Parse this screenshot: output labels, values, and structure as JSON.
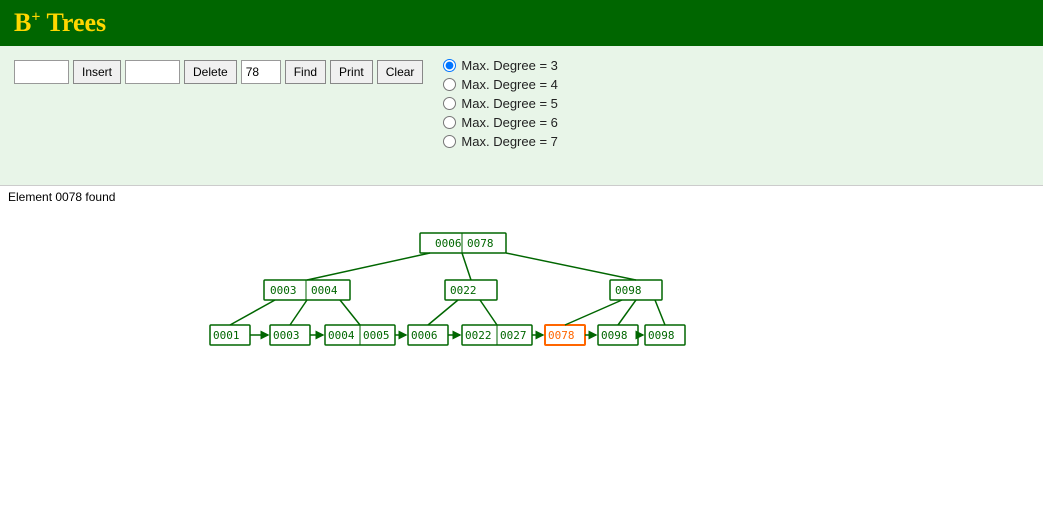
{
  "header": {
    "title": "B",
    "title_sup": "+",
    "title_suffix": " Trees"
  },
  "toolbar": {
    "insert_input_value": "",
    "insert_button_label": "Insert",
    "delete_input_value": "",
    "delete_button_label": "Delete",
    "find_input_value": "78",
    "find_button_label": "Find",
    "print_button_label": "Print",
    "clear_button_label": "Clear"
  },
  "degree_options": [
    {
      "label": "Max. Degree = 3",
      "value": "3",
      "selected": true
    },
    {
      "label": "Max. Degree = 4",
      "value": "4",
      "selected": false
    },
    {
      "label": "Max. Degree = 5",
      "value": "5",
      "selected": false
    },
    {
      "label": "Max. Degree = 6",
      "value": "6",
      "selected": false
    },
    {
      "label": "Max. Degree = 7",
      "value": "7",
      "selected": false
    }
  ],
  "status": {
    "message": "Element 0078 found"
  }
}
